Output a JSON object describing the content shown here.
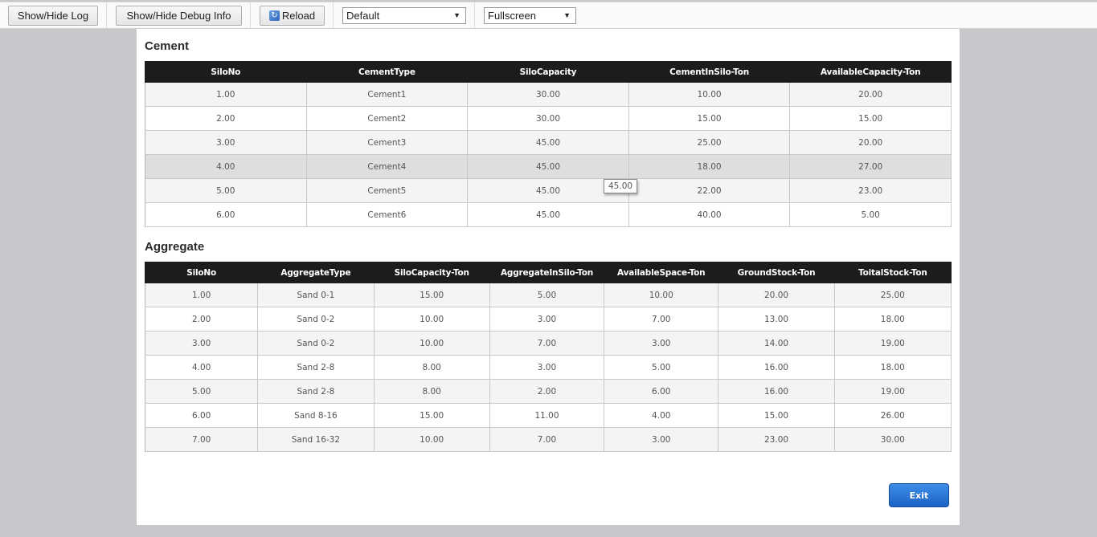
{
  "toolbar": {
    "log_label": "Show/Hide Log",
    "debug_label": "Show/Hide Debug Info",
    "reload_label": "Reload",
    "theme_value": "Default",
    "mode_value": "Fullscreen"
  },
  "cement": {
    "title": "Cement",
    "headers": [
      "SiloNo",
      "CementType",
      "SiloCapacity",
      "CementInSilo-Ton",
      "AvailableCapacity-Ton"
    ],
    "rows": [
      [
        "1.00",
        "Cement1",
        "30.00",
        "10.00",
        "20.00"
      ],
      [
        "2.00",
        "Cement2",
        "30.00",
        "15.00",
        "15.00"
      ],
      [
        "3.00",
        "Cement3",
        "45.00",
        "25.00",
        "20.00"
      ],
      [
        "4.00",
        "Cement4",
        "45.00",
        "18.00",
        "27.00"
      ],
      [
        "5.00",
        "Cement5",
        "45.00",
        "22.00",
        "23.00"
      ],
      [
        "6.00",
        "Cement6",
        "45.00",
        "40.00",
        "5.00"
      ]
    ]
  },
  "aggregate": {
    "title": "Aggregate",
    "headers": [
      "SiloNo",
      "AggregateType",
      "SiloCapacity-Ton",
      "AggregateInSilo-Ton",
      "AvailableSpace-Ton",
      "GroundStock-Ton",
      "ToitalStock-Ton"
    ],
    "rows": [
      [
        "1.00",
        "Sand 0-1",
        "15.00",
        "5.00",
        "10.00",
        "20.00",
        "25.00"
      ],
      [
        "2.00",
        "Sand 0-2",
        "10.00",
        "3.00",
        "7.00",
        "13.00",
        "18.00"
      ],
      [
        "3.00",
        "Sand 0-2",
        "10.00",
        "7.00",
        "3.00",
        "14.00",
        "19.00"
      ],
      [
        "4.00",
        "Sand 2-8",
        "8.00",
        "3.00",
        "5.00",
        "16.00",
        "18.00"
      ],
      [
        "5.00",
        "Sand 2-8",
        "8.00",
        "2.00",
        "6.00",
        "16.00",
        "19.00"
      ],
      [
        "6.00",
        "Sand 8-16",
        "15.00",
        "11.00",
        "4.00",
        "15.00",
        "26.00"
      ],
      [
        "7.00",
        "Sand 16-32",
        "10.00",
        "7.00",
        "3.00",
        "23.00",
        "30.00"
      ]
    ]
  },
  "tooltip": "45.00",
  "exit_label": "Exit"
}
